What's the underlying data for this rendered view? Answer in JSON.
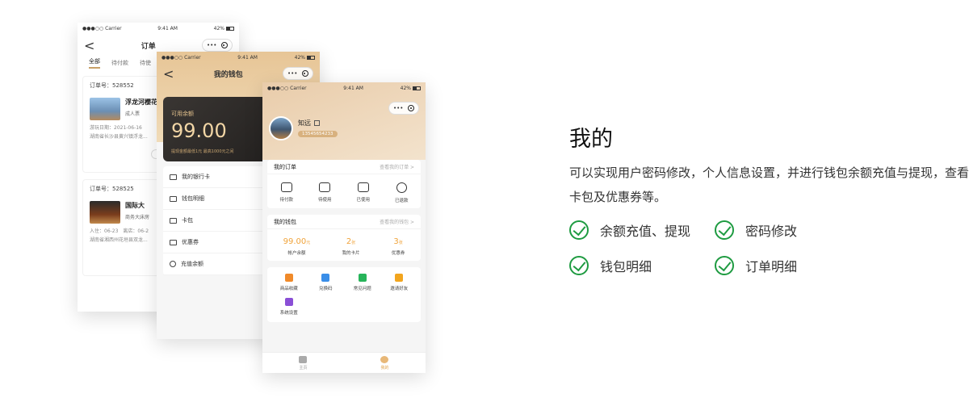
{
  "status": {
    "carrier": "●●●○○ Carrier",
    "time": "9:41 AM",
    "battery": "42%"
  },
  "capsule": {
    "more": "•••"
  },
  "orders_screen": {
    "title": "订单",
    "back": "<",
    "tabs": [
      "全部",
      "待付款",
      "待使"
    ],
    "orders": [
      {
        "number": "订单号：528552",
        "name": "浮龙河樱花",
        "sub": "成人票",
        "date": "游玩日期：2021-06-16",
        "address": "湖南省长沙县黄兴镇浮龙..."
      },
      {
        "number": "订单号：528525",
        "name": "国际大",
        "sub": "商务大床房",
        "date": "入住：06-23　离店：06-2",
        "address": "湖南省湘西州花垣县双龙..."
      }
    ]
  },
  "wallet_screen": {
    "title": "我的钱包",
    "back": "<",
    "card_label": "可用余额",
    "balance": "99.00",
    "card_note": "提现金额最低1元 最高1000元之间",
    "menu": [
      "我的银行卡",
      "钱包明细",
      "卡包",
      "优惠券",
      "充值余额"
    ]
  },
  "me_screen": {
    "user": "知远",
    "phone": "13545654233",
    "my_orders": {
      "title": "我的订单",
      "more": "查看我的订单 >",
      "items": [
        "待付款",
        "待使用",
        "已使用",
        "已退款"
      ]
    },
    "my_wallet": {
      "title": "我的钱包",
      "more": "查看我的钱包 >",
      "stats": [
        {
          "value": "99.00",
          "unit": "元",
          "label": "帐户余额"
        },
        {
          "value": "2",
          "unit": "张",
          "label": "我的卡片"
        },
        {
          "value": "3",
          "unit": "张",
          "label": "优惠券"
        }
      ]
    },
    "tools": [
      {
        "label": "商品收藏",
        "color": "#f08a2a"
      },
      {
        "label": "兑换码",
        "color": "#3a8ee8"
      },
      {
        "label": "常见问题",
        "color": "#27b45a"
      },
      {
        "label": "邀请好友",
        "color": "#f2a51e"
      },
      {
        "label": "系统设置",
        "color": "#8a4fd6"
      }
    ],
    "tabbar": [
      {
        "label": "主页"
      },
      {
        "label": "我的"
      }
    ]
  },
  "info": {
    "title": "我的",
    "description": "可以实现用户密码修改，个人信息设置，并进行钱包余额充值与提现，查看卡包及优惠券等。",
    "features": [
      "余额充值、提现",
      "密码修改",
      "钱包明细",
      "订单明细"
    ],
    "accent": "#1e9b41"
  }
}
